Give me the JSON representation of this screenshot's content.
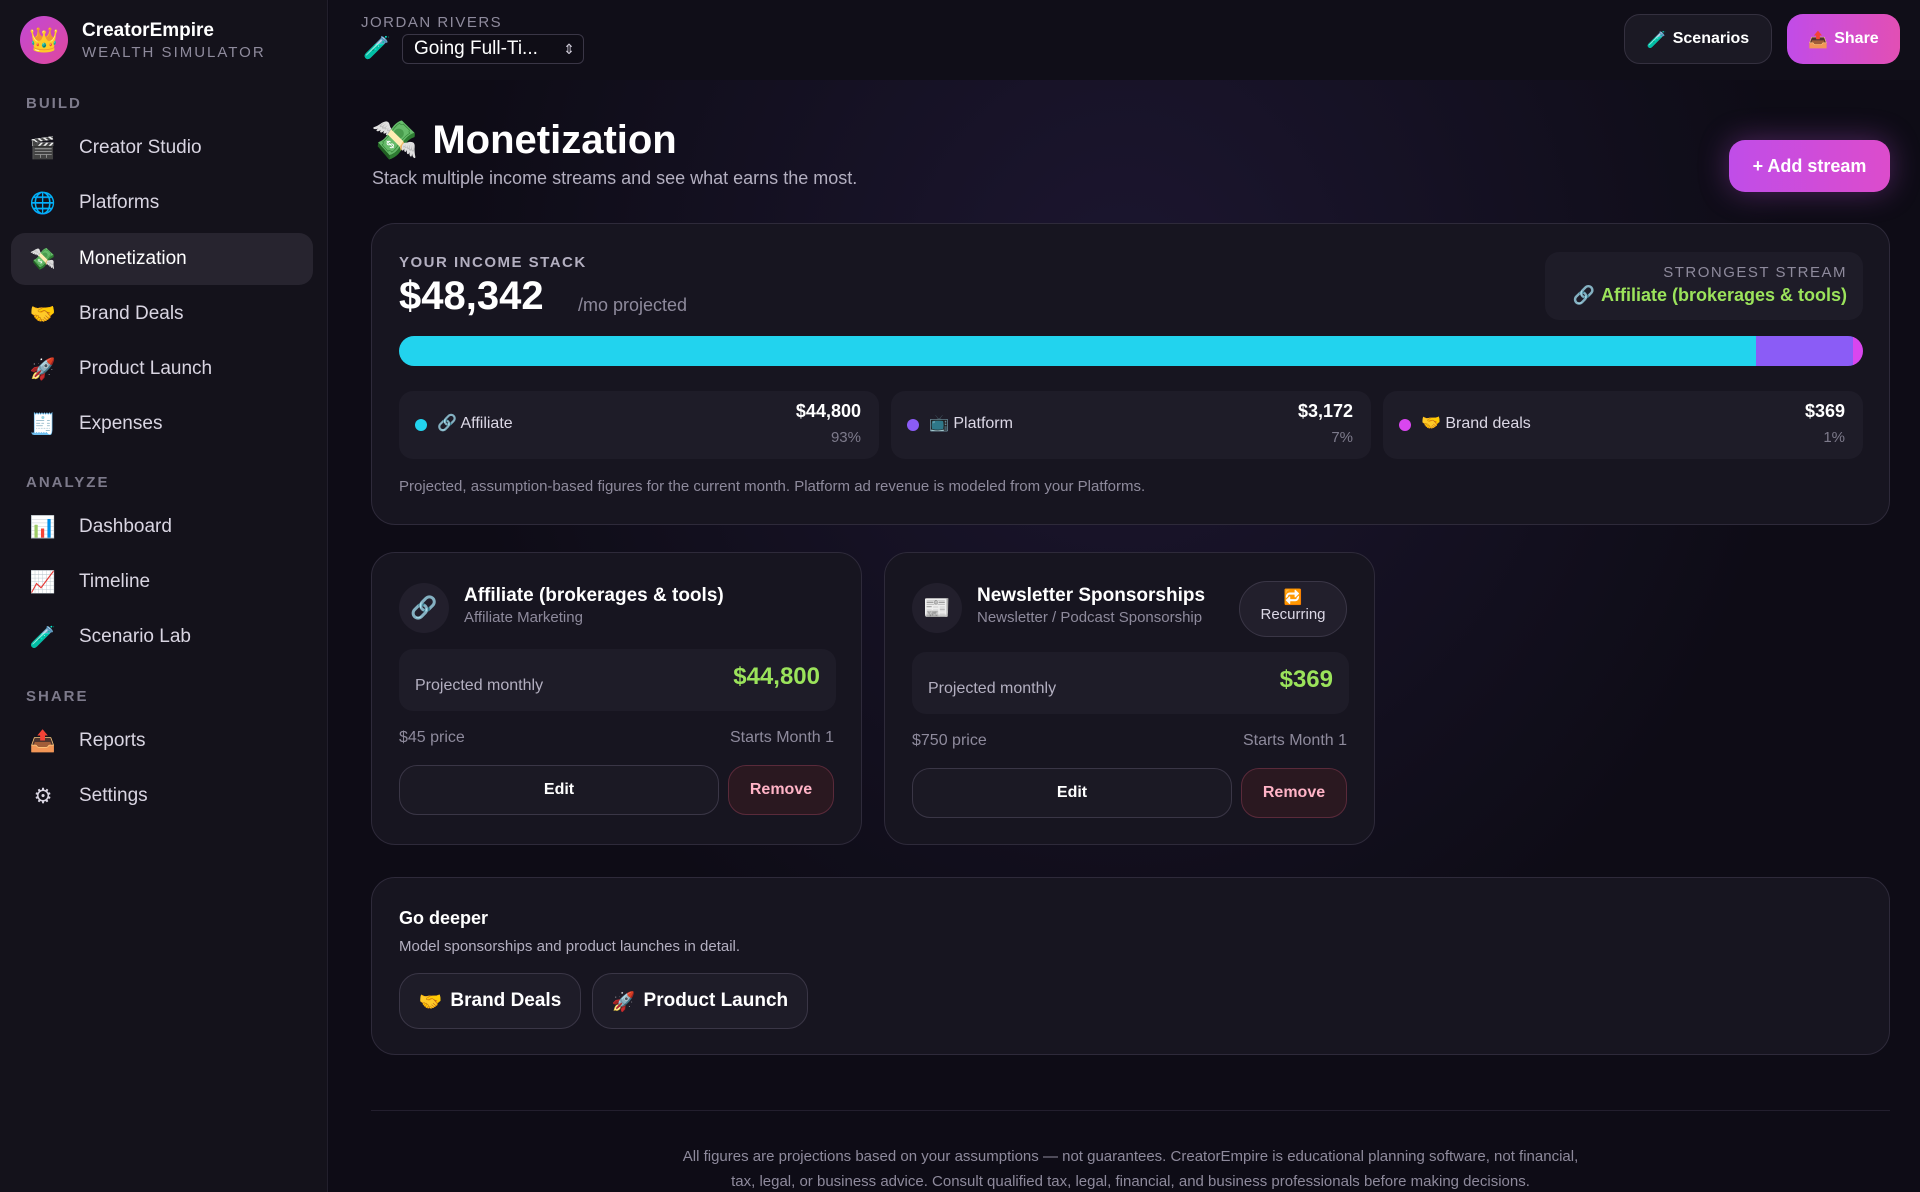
{
  "brand": {
    "name": "CreatorEmpire",
    "subtitle": "WEALTH SIMULATOR",
    "logo_icon": "👑"
  },
  "sidebar": {
    "sections": [
      {
        "title": "BUILD",
        "items": [
          {
            "label": "Creator Studio",
            "icon": "🎬"
          },
          {
            "label": "Platforms",
            "icon": "🌐"
          },
          {
            "label": "Monetization",
            "icon": "💸",
            "active": true
          },
          {
            "label": "Brand Deals",
            "icon": "🤝"
          },
          {
            "label": "Product Launch",
            "icon": "🚀"
          },
          {
            "label": "Expenses",
            "icon": "🧾"
          }
        ]
      },
      {
        "title": "ANALYZE",
        "items": [
          {
            "label": "Dashboard",
            "icon": "📊"
          },
          {
            "label": "Timeline",
            "icon": "📈"
          },
          {
            "label": "Scenario Lab",
            "icon": "🧪"
          }
        ]
      },
      {
        "title": "SHARE",
        "items": [
          {
            "label": "Reports",
            "icon": "📤"
          },
          {
            "label": "Settings",
            "icon": "⚙"
          }
        ]
      }
    ]
  },
  "topbar": {
    "user": "JORDAN RIVERS",
    "scenario_icon": "🧪",
    "scenario": "Going Full-Ti...",
    "scenarios_button": "Scenarios",
    "scenarios_icon": "🧪",
    "share_button": "Share",
    "share_icon": "📤"
  },
  "page": {
    "title": "Monetization",
    "title_icon": "💸",
    "subtitle": "Stack multiple income streams and see what earns the most.",
    "add_button": "+ Add stream"
  },
  "income_stack": {
    "label": "YOUR INCOME STACK",
    "total": "$48,342",
    "unit": "/mo projected",
    "strongest_label": "STRONGEST STREAM",
    "strongest_icon": "🔗",
    "strongest_value": "Affiliate (brokerages & tools)",
    "breakdown": [
      {
        "label": "Affiliate",
        "icon": "🔗",
        "amount": "$44,800",
        "pct": "93%",
        "share": 0.927,
        "color": "#22d3ee"
      },
      {
        "label": "Platform",
        "icon": "📺",
        "amount": "$3,172",
        "pct": "7%",
        "share": 0.066,
        "color": "#8b5cf6"
      },
      {
        "label": "Brand deals",
        "icon": "🤝",
        "amount": "$369",
        "pct": "1%",
        "share": 0.007,
        "color": "#d946ef"
      }
    ],
    "note": "Projected, assumption-based figures for the current month. Platform ad revenue is modeled from your Platforms."
  },
  "streams": [
    {
      "icon": "🔗",
      "title": "Affiliate (brokerages & tools)",
      "category": "Affiliate Marketing",
      "badge": null,
      "projected_label": "Projected monthly",
      "projected_value": "$44,800",
      "price": "$45 price",
      "start": "Starts Month 1",
      "edit": "Edit",
      "remove": "Remove"
    },
    {
      "icon": "📰",
      "title": "Newsletter Sponsorships",
      "category": "Newsletter / Podcast Sponsorship",
      "badge": {
        "icon": "🔁",
        "label": "Recurring"
      },
      "projected_label": "Projected monthly",
      "projected_value": "$369",
      "price": "$750 price",
      "start": "Starts Month 1",
      "edit": "Edit",
      "remove": "Remove"
    }
  ],
  "go_deeper": {
    "title": "Go deeper",
    "subtitle": "Model sponsorships and product launches in detail.",
    "buttons": [
      {
        "icon": "🤝",
        "label": "Brand Deals"
      },
      {
        "icon": "🚀",
        "label": "Product Launch"
      }
    ]
  },
  "footer": {
    "line1": "All figures are projections based on your assumptions — not guarantees. CreatorEmpire is educational planning software, not financial,",
    "line2": "tax, legal, or business advice. Consult qualified tax, legal, financial, and business professionals before making decisions."
  }
}
